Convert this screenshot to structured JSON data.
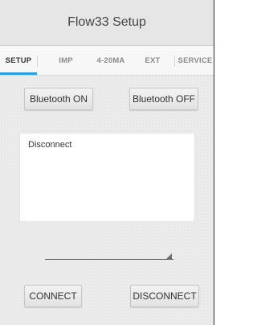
{
  "title": "Flow33 Setup",
  "tabs": [
    {
      "label": "SETUP",
      "active": true
    },
    {
      "label": "IMP",
      "active": false
    },
    {
      "label": "4-20MA",
      "active": false
    },
    {
      "label": "EXT",
      "active": false
    },
    {
      "label": "SERVICE",
      "active": false
    }
  ],
  "bluetooth": {
    "on_label": "Bluetooth ON",
    "off_label": "Bluetooth OFF"
  },
  "log": {
    "text": "Disconnect"
  },
  "spinner": {
    "value": ""
  },
  "connection": {
    "connect_label": "CONNECT",
    "disconnect_label": "DISCONNECT"
  },
  "colors": {
    "accent": "#2a9fe0"
  }
}
